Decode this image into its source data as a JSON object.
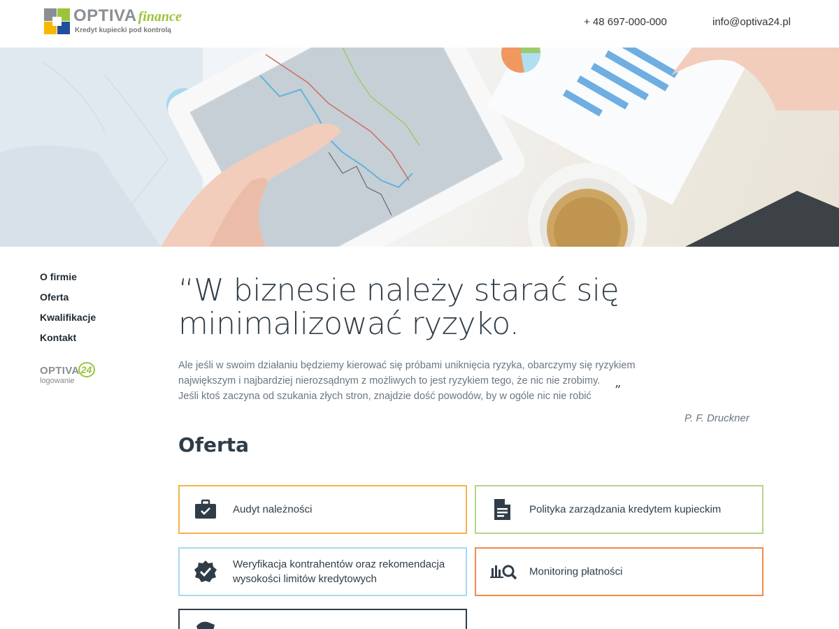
{
  "header": {
    "brand": "OPTIVA",
    "brand_suffix": "finance",
    "tagline": "Kredyt kupiecki pod kontrolą",
    "phone": "+ 48 697-000-000",
    "email": "info@optiva24.pl"
  },
  "sidebar": {
    "items": [
      {
        "label": "O firmie"
      },
      {
        "label": "Oferta"
      },
      {
        "label": "Kwalifikacje"
      },
      {
        "label": "Kontakt"
      }
    ],
    "login_brand": "OPTIVA",
    "login_brand_number": "24",
    "login_label": "logowanie"
  },
  "quote": {
    "title": "“W biznesie należy starać się minimalizować ryzyko.",
    "body_line1": "Ale jeśli w swoim działaniu będziemy kierować się próbami uniknięcia ryzyka, obarczymy się ryzykiem",
    "body_line2": "największym i najbardziej nierozsądnym z możliwych to jest ryzykiem tego, że nic nie zrobimy.",
    "body_line3": "Jeśli ktoś zaczyna od szukania złych stron, znajdzie dość powodów, by w ogóle nic nie robić",
    "close_mark": "”",
    "author": "P. F. Druckner"
  },
  "offer": {
    "title": "Oferta",
    "items": [
      {
        "label": "Audyt należności",
        "icon": "briefcase-check-icon",
        "color": "#f5b24a"
      },
      {
        "label": "Polityka zarządzania kredytem kupieckim",
        "icon": "document-icon",
        "color": "#b5d48a"
      },
      {
        "label": "Weryfikacja kontrahentów oraz rekomendacja wysokości limitów kredytowych",
        "icon": "verified-badge-icon",
        "color": "#a8daf0"
      },
      {
        "label": "Monitoring płatności",
        "icon": "chart-search-icon",
        "color": "#f08a4b"
      },
      {
        "label": "",
        "icon": "partial-icon",
        "color": "#2f3d48"
      }
    ]
  },
  "colors": {
    "text_dark": "#2f3d48",
    "accent_green": "#9cc43a",
    "logo_gray": "#8a8f93"
  }
}
